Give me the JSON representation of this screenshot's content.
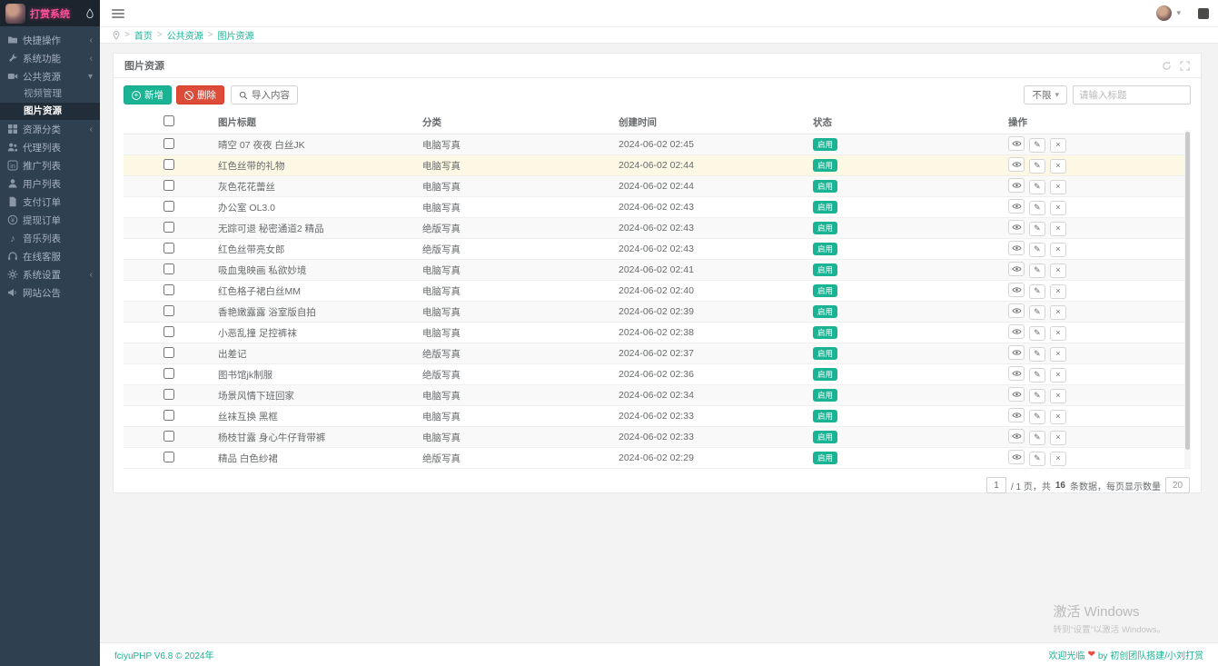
{
  "colors": {
    "accent_teal": "#1ab394",
    "danger_red": "#dd4b39",
    "sidebar_bg": "#2f4050",
    "logo_pink": "#ff4f9a",
    "badge_green": "#1ab394",
    "row_highlight": "#fcf8e3"
  },
  "sidebar": {
    "logo_title": "打赏系统",
    "items": [
      {
        "label": "快捷操作",
        "icon": "folder-icon",
        "chevron": "left"
      },
      {
        "label": "系统功能",
        "icon": "wrench-icon",
        "chevron": "left"
      },
      {
        "label": "公共资源",
        "icon": "video-icon",
        "chevron": "down",
        "active": true,
        "children": [
          {
            "label": "视频管理"
          },
          {
            "label": "图片资源",
            "active": true
          }
        ]
      },
      {
        "label": "资源分类",
        "icon": "grid-icon",
        "chevron": "left"
      },
      {
        "label": "代理列表",
        "icon": "users-icon"
      },
      {
        "label": "推广列表",
        "icon": "share-icon"
      },
      {
        "label": "用户列表",
        "icon": "user-icon"
      },
      {
        "label": "支付订单",
        "icon": "file-icon"
      },
      {
        "label": "提现订单",
        "icon": "money-icon"
      },
      {
        "label": "音乐列表",
        "icon": "music-icon"
      },
      {
        "label": "在线客服",
        "icon": "service-icon"
      },
      {
        "label": "系统设置",
        "icon": "gear-icon",
        "chevron": "left"
      },
      {
        "label": "网站公告",
        "icon": "announcement-icon"
      }
    ]
  },
  "breadcrumb": {
    "separator": ">",
    "items": [
      "首页",
      "公共资源",
      "图片资源"
    ]
  },
  "card": {
    "title": "图片资源",
    "toolbar": {
      "add_label": "新增",
      "delete_label": "删除",
      "import_label": "导入内容",
      "filter_label": "不限",
      "search_placeholder": "请输入标题"
    },
    "table": {
      "headers": [
        "图片标题",
        "分类",
        "创建时间",
        "状态",
        "操作"
      ],
      "rows": [
        {
          "title": "晴空 07 夜夜 白丝JK",
          "category": "电脑写真",
          "created": "2024-06-02 02:45",
          "status": "启用"
        },
        {
          "title": "红色丝带的礼物",
          "category": "电脑写真",
          "created": "2024-06-02 02:44",
          "status": "启用",
          "highlight": true
        },
        {
          "title": "灰色花花蕾丝",
          "category": "电脑写真",
          "created": "2024-06-02 02:44",
          "status": "启用"
        },
        {
          "title": "办公室 OL3.0",
          "category": "电脑写真",
          "created": "2024-06-02 02:43",
          "status": "启用"
        },
        {
          "title": "无踪可退 秘密通道2 精品",
          "category": "绝版写真",
          "created": "2024-06-02 02:43",
          "status": "启用"
        },
        {
          "title": "红色丝带亮女郎",
          "category": "绝版写真",
          "created": "2024-06-02 02:43",
          "status": "启用"
        },
        {
          "title": "吸血鬼映画 私欲妙境",
          "category": "电脑写真",
          "created": "2024-06-02 02:41",
          "status": "启用"
        },
        {
          "title": "红色格子裙白丝MM",
          "category": "电脑写真",
          "created": "2024-06-02 02:40",
          "status": "启用"
        },
        {
          "title": "香艳嫩露露 浴室版自拍",
          "category": "电脑写真",
          "created": "2024-06-02 02:39",
          "status": "启用"
        },
        {
          "title": "小恶乱撞 足控裤袜",
          "category": "电脑写真",
          "created": "2024-06-02 02:38",
          "status": "启用"
        },
        {
          "title": "出差记",
          "category": "绝版写真",
          "created": "2024-06-02 02:37",
          "status": "启用"
        },
        {
          "title": "图书馆jk制服",
          "category": "绝版写真",
          "created": "2024-06-02 02:36",
          "status": "启用"
        },
        {
          "title": "场景风情下班回家",
          "category": "电脑写真",
          "created": "2024-06-02 02:34",
          "status": "启用"
        },
        {
          "title": "丝袜互换 黑框",
          "category": "电脑写真",
          "created": "2024-06-02 02:33",
          "status": "启用"
        },
        {
          "title": "杨枝甘露 身心牛仔背带裤",
          "category": "电脑写真",
          "created": "2024-06-02 02:33",
          "status": "启用"
        },
        {
          "title": "精品 白色纱裙",
          "category": "绝版写真",
          "created": "2024-06-02 02:29",
          "status": "启用"
        }
      ]
    },
    "pagination": {
      "page": "1",
      "info_pre": "/ 1 页，共",
      "total": "16",
      "info_post": "条数据，每页显示数量",
      "page_size": "20"
    }
  },
  "footer": {
    "left": "fciyuPHP V6.8 © 2024年",
    "right_pre": "欢迎光临",
    "right_heart": "❤",
    "right_post": "by 初创团队搭建/小刘打赏"
  },
  "watermark": {
    "line1": "激活 Windows",
    "line2": "转到“设置”以激活 Windows。"
  }
}
